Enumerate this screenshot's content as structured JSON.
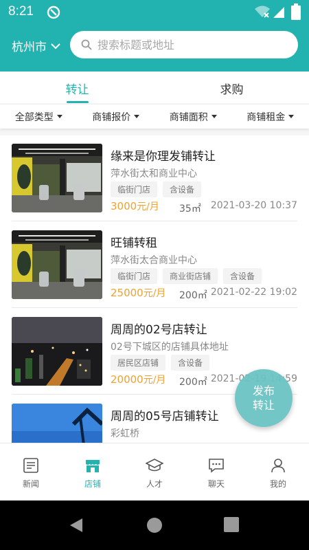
{
  "status_bar": {
    "time": "8:21"
  },
  "header": {
    "city": "杭州市",
    "search_placeholder": "搜索标题或地址"
  },
  "tabs": [
    {
      "label": "转让",
      "active": true
    },
    {
      "label": "求购",
      "active": false
    }
  ],
  "filters": [
    {
      "label": "全部类型"
    },
    {
      "label": "商铺报价"
    },
    {
      "label": "商铺面积"
    },
    {
      "label": "商铺租金"
    }
  ],
  "listings": [
    {
      "title": "缘来是你理发铺转让",
      "address": "萍水街太和商业中心",
      "tags": [
        "临街门店",
        "含设备"
      ],
      "price": "3000",
      "price_unit": "元/月",
      "area": "35㎡",
      "date": "2021-03-20 10:37"
    },
    {
      "title": "旺铺转租",
      "address": "萍水街太合商业中心",
      "tags": [
        "临街门店",
        "商业街店铺",
        "含设备"
      ],
      "price": "25000",
      "price_unit": "元/月",
      "area": "200㎡",
      "date": "2021-02-22 19:02"
    },
    {
      "title": "周周的02号店转让",
      "address": "02号下城区的店铺具体地址",
      "tags": [
        "居民区店铺",
        "含设备"
      ],
      "price": "20000",
      "price_unit": "元/月",
      "area": "200㎡",
      "date": "2021-02-19 14:59"
    },
    {
      "title": "周周的05号店铺转让",
      "address": "彩虹桥",
      "tags": [],
      "price": "",
      "price_unit": "",
      "area": "",
      "date": ""
    }
  ],
  "fab": {
    "line1": "发布",
    "line2": "转让"
  },
  "bottom_nav": [
    {
      "label": "新闻",
      "icon": "news-icon",
      "active": false
    },
    {
      "label": "店铺",
      "icon": "store-icon",
      "active": true
    },
    {
      "label": "人才",
      "icon": "graduation-cap-icon",
      "active": false
    },
    {
      "label": "聊天",
      "icon": "chat-icon",
      "active": false
    },
    {
      "label": "我的",
      "icon": "user-icon",
      "active": false
    }
  ],
  "colors": {
    "brand": "#22b3b0",
    "price": "#f0a030",
    "fab": "#6cc3c4"
  }
}
